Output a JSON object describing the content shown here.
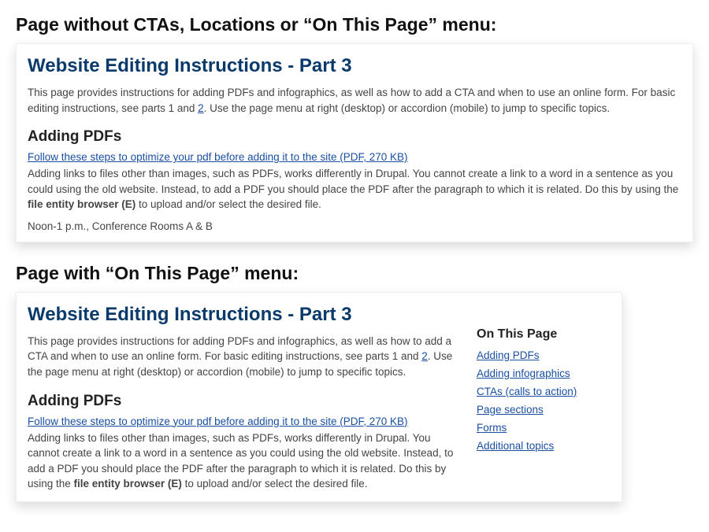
{
  "section1": {
    "heading": "Page without CTAs, Locations or “On This Page” menu:"
  },
  "section2": {
    "heading": "Page with “On This Page” menu:"
  },
  "page": {
    "title": "Website Editing Instructions - Part 3",
    "intro_before": "This page provides instructions for adding PDFs and infographics, as well as how to add a CTA and when to use an online form. For basic editing instructions, see parts 1 and ",
    "intro_link": "2",
    "intro_after": ". Use the page menu at right (desktop) or accordion (mobile) to jump to specific topics.",
    "subhead": "Adding PDFs",
    "pdf_link": "Follow these steps to optimize your pdf before adding it to the site (PDF, 270 KB)",
    "body_before": "Adding links to files other than images, such as PDFs, works differently in Drupal. You cannot create a link to a word in a sentence as you could using the old website. Instead, to add a PDF you should place the PDF after the paragraph to which it is related. Do this by using the ",
    "body_bold": "file entity browser (E)",
    "body_after": " to upload and/or select the desired file.",
    "footer": "Noon-1 p.m., Conference Rooms A & B"
  },
  "on_this_page": {
    "heading": "On This Page",
    "items": [
      "Adding PDFs",
      "Adding infographics",
      "CTAs (calls to action)",
      "Page sections",
      "Forms",
      "Additional topics"
    ]
  }
}
